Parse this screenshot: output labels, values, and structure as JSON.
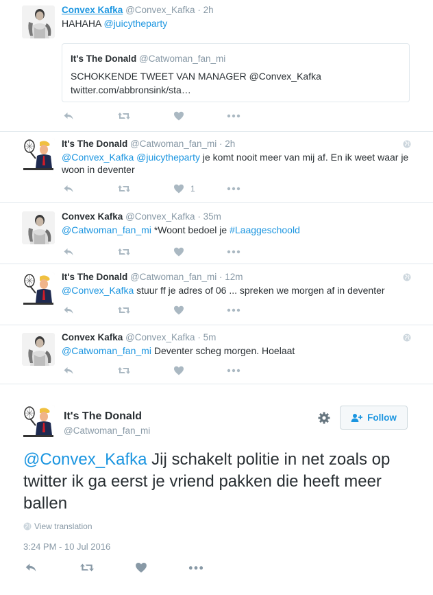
{
  "tweets": [
    {
      "name": "Convex Kafka",
      "handle": "@Convex_Kafka",
      "dot": "·",
      "time": "2h",
      "text_mention": "HAHAHA ",
      "text_link": "@juicytheparty",
      "quote": {
        "name": "It's The Donald",
        "handle": "@Catwoman_fan_mi",
        "line1": "SCHOKKENDE TWEET VAN MANAGER @Convex_Kafka",
        "line2": "twitter.com/abbronsink/sta…"
      }
    },
    {
      "name": "It's The Donald",
      "handle": "@Catwoman_fan_mi",
      "dot": "·",
      "time": "2h",
      "link1": "@Convex_Kafka",
      "link2": "@juicytheparty",
      "rest": " je komt nooit meer van mij af. En ik weet waar je woon in deventer",
      "like_count": "1"
    },
    {
      "name": "Convex Kafka",
      "handle": "@Convex_Kafka",
      "dot": "·",
      "time": "35m",
      "link1": "@Catwoman_fan_mi",
      "mid": " *Woont bedoel je ",
      "hashtag": "#Laaggeschoold"
    },
    {
      "name": "It's The Donald",
      "handle": "@Catwoman_fan_mi",
      "dot": "·",
      "time": "12m",
      "link1": "@Convex_Kafka",
      "rest": " stuur ff je adres of 06 ... spreken we morgen af in deventer"
    },
    {
      "name": "Convex Kafka",
      "handle": "@Convex_Kafka",
      "dot": "·",
      "time": "5m",
      "link1": "@Catwoman_fan_mi",
      "rest": " Deventer scheg morgen. Hoelaat"
    }
  ],
  "main": {
    "name": "It's The Donald",
    "handle": "@Catwoman_fan_mi",
    "follow_label": "Follow",
    "mention": "@Convex_Kafka",
    "text": " Jij schakelt politie in net zoals op twitter  ik ga eerst je vriend pakken die heeft meer ballen",
    "view_translation": "View translation",
    "timestamp": "3:24 PM - 10 Jul 2016"
  },
  "icons": {
    "reply": "reply-icon",
    "retweet": "retweet-icon",
    "like": "heart-icon",
    "more": "more-icon",
    "globe": "globe-icon",
    "gear": "gear-icon",
    "follow": "follow-user-icon"
  },
  "colors": {
    "link": "#1b95e0",
    "muted": "#8899a6",
    "action": "#aab8c2",
    "border": "#e1e8ed"
  }
}
